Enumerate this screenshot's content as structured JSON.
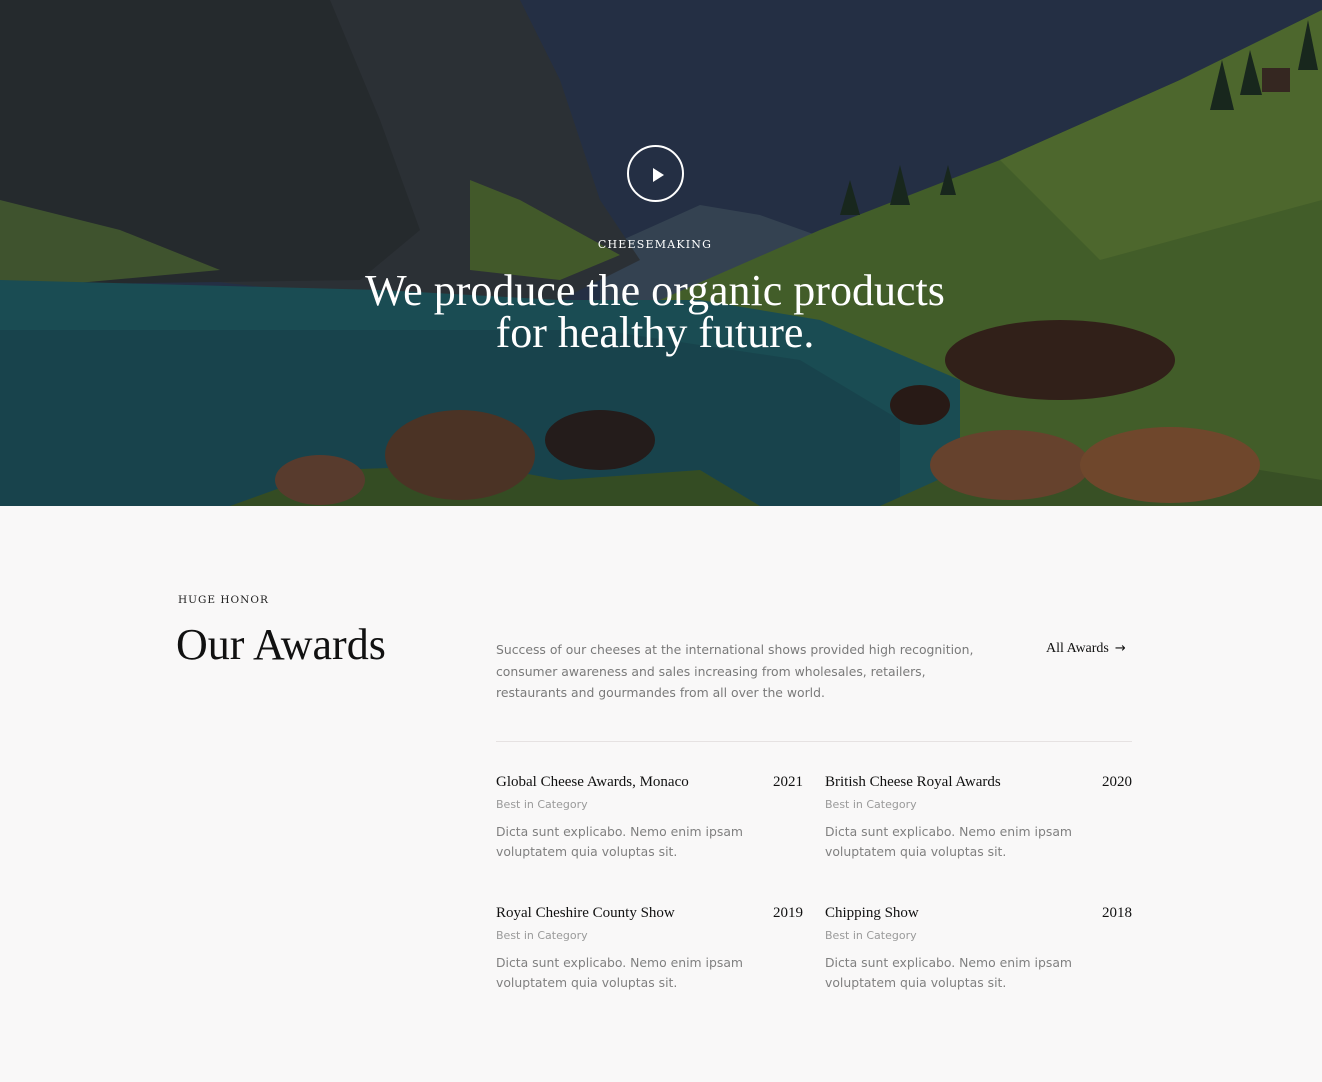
{
  "hero": {
    "kicker": "CHEESEMAKING",
    "title_line1": "We produce the organic products",
    "title_line2": "for healthy future.",
    "play_icon": "play-icon"
  },
  "awards": {
    "kicker": "HUGE HONOR",
    "title": "Our Awards",
    "description": "Success of our cheeses at the international shows provided high recognition, consumer awareness and sales increasing from wholesales, retailers, restaurants and gourmandes from all over the world.",
    "all_awards_label": "All Awards",
    "all_awards_icon": "arrow-right-icon",
    "items": [
      {
        "name": "Global Cheese Awards, Monaco",
        "year": "2021",
        "category": "Best in Category",
        "text": "Dicta sunt explicabo. Nemo enim ipsam voluptatem quia voluptas sit."
      },
      {
        "name": "British Cheese Royal Awards",
        "year": "2020",
        "category": "Best in Category",
        "text": "Dicta sunt explicabo. Nemo enim ipsam voluptatem quia voluptas sit."
      },
      {
        "name": "Royal Cheshire County Show",
        "year": "2019",
        "category": "Best in Category",
        "text": "Dicta sunt explicabo. Nemo enim ipsam voluptatem quia voluptas sit."
      },
      {
        "name": "Chipping Show",
        "year": "2018",
        "category": "Best in Category",
        "text": "Dicta sunt explicabo. Nemo enim ipsam voluptatem quia voluptas sit."
      }
    ]
  },
  "colors": {
    "page_background": "#f9f8f8",
    "heading": "#111111",
    "body_text": "#7a7a7a",
    "divider": "#e6e2e2"
  }
}
